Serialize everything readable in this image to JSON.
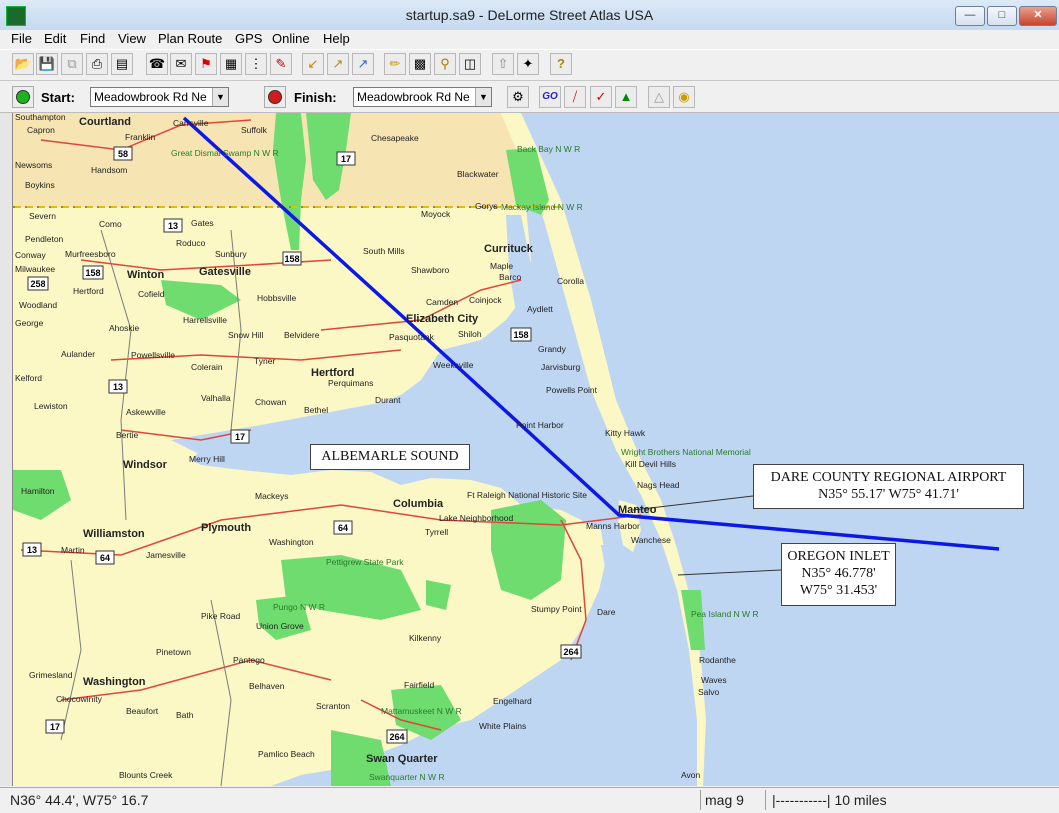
{
  "window": {
    "title": "startup.sa9 - DeLorme Street Atlas USA"
  },
  "menus": [
    "File",
    "Edit",
    "Find",
    "View",
    "Plan Route",
    "GPS",
    "Online",
    "Help"
  ],
  "route": {
    "start_label": "Start:",
    "start_value": "Meadowbrook Rd Ne",
    "finish_label": "Finish:",
    "finish_value": "Meadowbrook Rd Ne"
  },
  "map": {
    "callouts": {
      "sound": "ALBEMARLE SOUND",
      "airport_name": "DARE COUNTY REGIONAL AIRPORT",
      "airport_coords": "N35° 55.17'  W75° 41.71'",
      "inlet_name": "OREGON INLET",
      "inlet_lat": "N35° 46.778'",
      "inlet_lon": "W75° 31.453'"
    },
    "places_major": [
      "Courtland",
      "Winton",
      "Gatesville",
      "Elizabeth City",
      "Hertford",
      "Currituck",
      "Windsor",
      "Columbia",
      "Plymouth",
      "Williamston",
      "Washington",
      "Manteo",
      "Swan Quarter"
    ],
    "places_minor": [
      "Southampton",
      "Capron",
      "Franklin",
      "Courtland",
      "Carrsville",
      "Suffolk",
      "Chesapeake",
      "Newsoms",
      "Handsom",
      "Boykins",
      "Blackwater",
      "Back Bay N W R",
      "Great Dismal Swamp N W R",
      "Severn",
      "Como",
      "Gates",
      "Moyock",
      "Corolla",
      "Gorys",
      "Mackay Island N W R",
      "Pendleton",
      "Roduco",
      "Sunbury",
      "South Mills",
      "Conway",
      "Murfreesboro",
      "Milwaukee",
      "Shawboro",
      "Maple",
      "Barco",
      "Hertford",
      "Cofield",
      "Hobbsville",
      "Camden",
      "Coinjock",
      "Aydlett",
      "Woodland",
      "George",
      "Ahoskie",
      "Harrellsville",
      "Snow Hill",
      "Belvidere",
      "Shiloh",
      "Pasquotank",
      "Grandy",
      "Aulander",
      "Powellsville",
      "Colerain",
      "Tyner",
      "Jarvisburg",
      "Weeksville",
      "Perquimans",
      "Powells Point",
      "Kelford",
      "Lewiston",
      "Askewville",
      "Valhalla",
      "Chowan",
      "Durant",
      "Bethel",
      "Point Harbor",
      "Kitty Hawk",
      "Bertie",
      "Wright Brothers National Memorial",
      "Kill Devil Hills",
      "Merry Hill",
      "Nags Head",
      "Hamilton",
      "Mackeys",
      "Ft Raleigh National Historic Site",
      "Lake Neighborhood",
      "Manns Harbor",
      "Tyrrell",
      "Wanchese",
      "Martin",
      "Jamesville",
      "Washington",
      "Pettigrew State Park",
      "Pungo N W R",
      "Stumpy Point",
      "Dare",
      "Pea Island N W R",
      "Pike Road",
      "Union Grove",
      "Kilkenny",
      "Pinetown",
      "Pantego",
      "Rodanthe",
      "Grimesland",
      "Belhaven",
      "Fairfield",
      "Waves",
      "Chocowinity",
      "Beaufort",
      "Bath",
      "Scranton",
      "Mattamuskeet N W R",
      "Engelhard",
      "Salvo",
      "White Plains",
      "Pamlico Beach",
      "Blounts Creek",
      "Swanquarter N W R",
      "Avon"
    ],
    "shields": [
      "58",
      "17",
      "13",
      "158",
      "158",
      "258",
      "13",
      "158",
      "17",
      "13",
      "64",
      "64",
      "17",
      "264",
      "264"
    ]
  },
  "status": {
    "coords": "N36° 44.4', W75° 16.7",
    "mag": "mag 9",
    "scale": "|-----------| 10 miles"
  },
  "colors": {
    "water": "#bfd6f2",
    "land": "#fbf8c6",
    "virginia": "#f7e4b3",
    "park": "#6fdc6f",
    "route": "#0b18e6",
    "road": "#e0463a"
  }
}
